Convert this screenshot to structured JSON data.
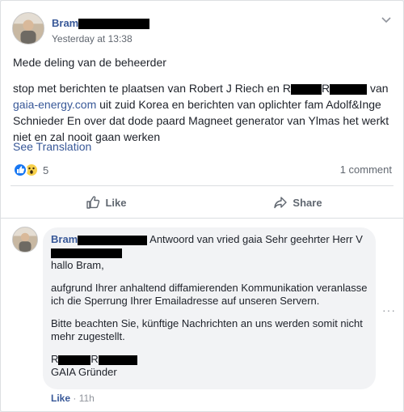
{
  "post": {
    "author_visible": "Bram",
    "timestamp": "Yesterday at 13:38",
    "paragraph1": "Mede deling van de beheerder",
    "p2_part1": "stop met berichten te plaatsen van Robert J Riech en R",
    "p2_part2": "R",
    "p2_part3": " van ",
    "p2_link": "gaia-energy.com",
    "p2_part4": " uit zuid Korea en berichten van oplichter fam Adolf&Inge Schnieder En over dat dode paard Magneet generator van Ylmas het werkt niet en zal nooit gaan werken",
    "see_translation": "See Translation",
    "reaction_count": "5",
    "comment_count": "1 comment"
  },
  "actions": {
    "like": "Like",
    "share": "Share"
  },
  "comment": {
    "author_visible": "Bram",
    "after_author": " Antwoord van vried gaia Sehr geehrter Herr V",
    "greeting": "hallo Bram,",
    "body1": "aufgrund Ihrer anhaltend diffamierenden Kommunikation veranlasse ich die Sperrung Ihrer Emailadresse auf unseren Servern.",
    "body2": "Bitte beachten Sie, künftige Nachrichten an uns werden somit nicht mehr zugestellt.",
    "sig_r1": "R",
    "sig_r2": "R",
    "sig_role": "GAIA Gründer",
    "like": "Like",
    "sep": " · ",
    "time": "11h",
    "more": "···"
  },
  "colors": {
    "link": "#385898",
    "like_reaction": "#1877f2",
    "wow_reaction": "#f7d04b",
    "redaction": "#000000"
  },
  "icons": [
    "chevron-down-icon",
    "like-reaction-icon",
    "wow-reaction-icon",
    "thumbs-up-icon",
    "share-arrow-icon",
    "more-dots-icon"
  ]
}
